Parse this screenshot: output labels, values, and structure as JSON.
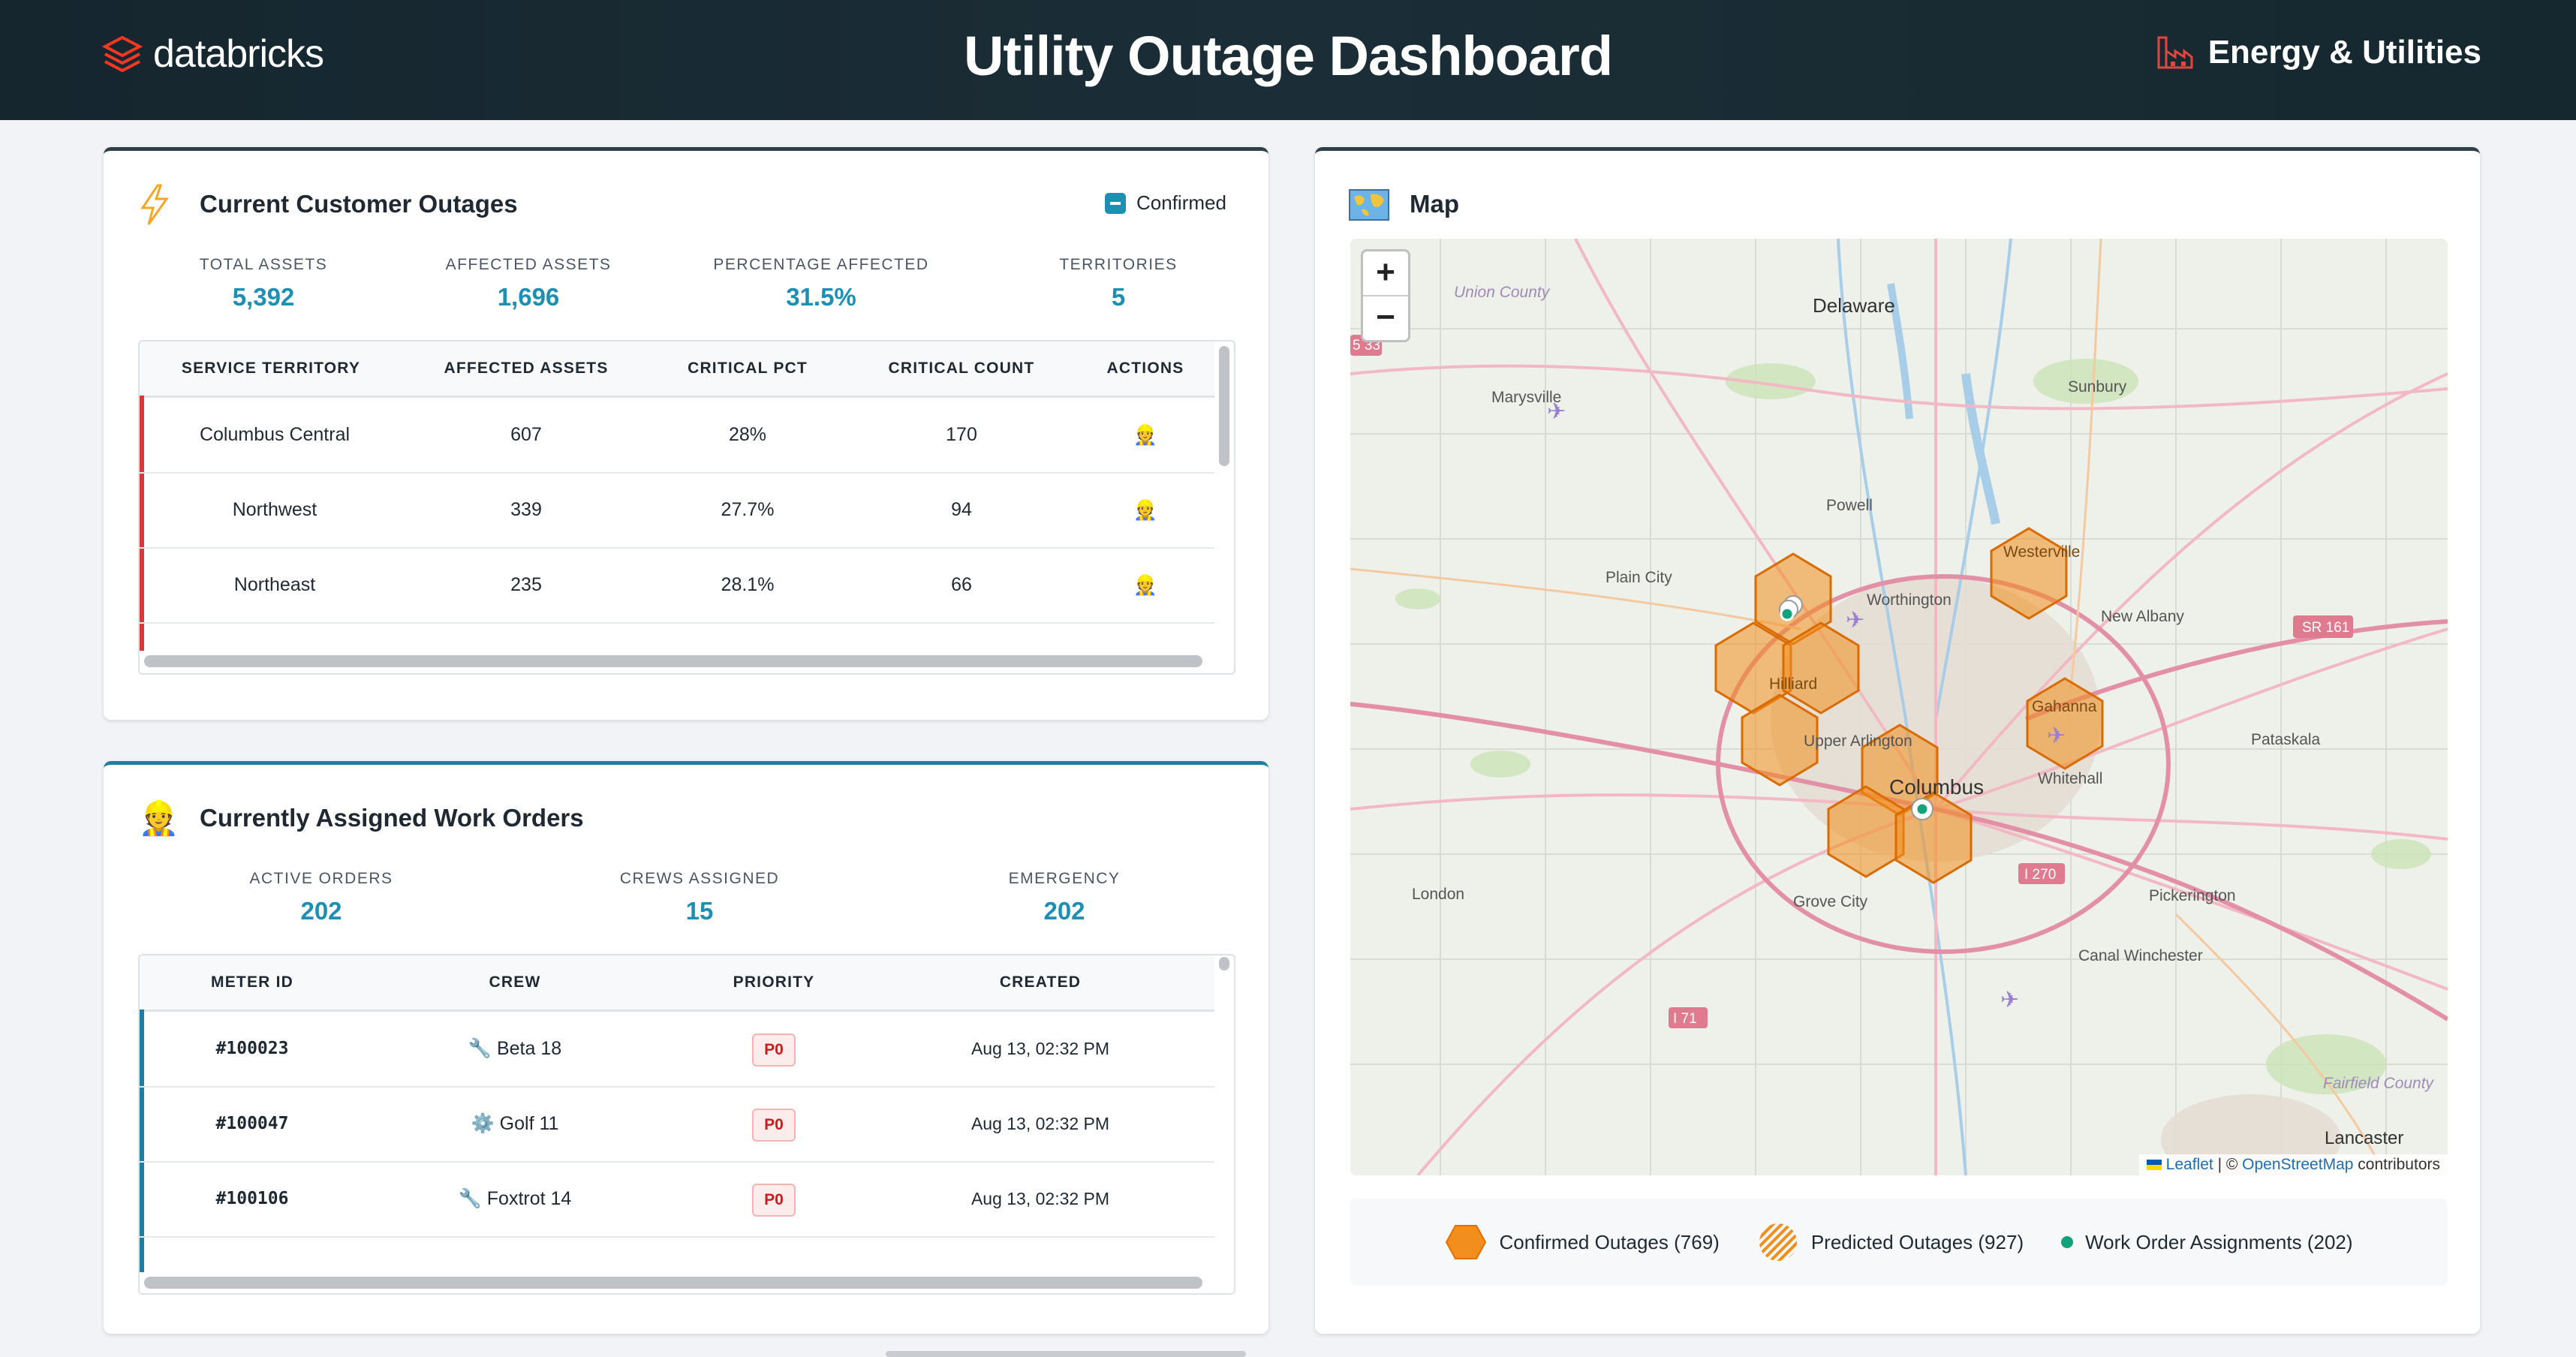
{
  "header": {
    "brand": "databricks",
    "title": "Utility Outage Dashboard",
    "industry": "Energy & Utilities"
  },
  "outages": {
    "title": "Current Customer Outages",
    "filter_label": "Confirmed",
    "metrics": [
      {
        "label": "TOTAL ASSETS",
        "value": "5,392"
      },
      {
        "label": "AFFECTED ASSETS",
        "value": "1,696"
      },
      {
        "label": "PERCENTAGE AFFECTED",
        "value": "31.5%"
      },
      {
        "label": "TERRITORIES",
        "value": "5"
      }
    ],
    "columns": [
      "SERVICE TERRITORY",
      "AFFECTED ASSETS",
      "CRITICAL PCT",
      "CRITICAL COUNT",
      "ACTIONS"
    ],
    "rows": [
      {
        "territory": "Columbus Central",
        "affected": "607",
        "pct": "28%",
        "count": "170",
        "action": "👷"
      },
      {
        "territory": "Northwest",
        "affected": "339",
        "pct": "27.7%",
        "count": "94",
        "action": "👷"
      },
      {
        "territory": "Northeast",
        "affected": "235",
        "pct": "28.1%",
        "count": "66",
        "action": "👷"
      }
    ]
  },
  "workorders": {
    "title": "Currently Assigned Work Orders",
    "metrics": [
      {
        "label": "ACTIVE ORDERS",
        "value": "202"
      },
      {
        "label": "CREWS ASSIGNED",
        "value": "15"
      },
      {
        "label": "EMERGENCY",
        "value": "202"
      }
    ],
    "columns": [
      "METER ID",
      "CREW",
      "PRIORITY",
      "CREATED"
    ],
    "rows": [
      {
        "meter": "#100023",
        "crew_icon": "🔧",
        "crew": "Beta 18",
        "priority": "P0",
        "created": "Aug 13, 02:32 PM"
      },
      {
        "meter": "#100047",
        "crew_icon": "⚙️",
        "crew": "Golf 11",
        "priority": "P0",
        "created": "Aug 13, 02:32 PM"
      },
      {
        "meter": "#100106",
        "crew_icon": "🔧",
        "crew": "Foxtrot 14",
        "priority": "P0",
        "created": "Aug 13, 02:32 PM"
      }
    ]
  },
  "map": {
    "title": "Map",
    "zoom_in": "+",
    "zoom_out": "−",
    "attribution": {
      "leaflet": "Leaflet",
      "sep": " | © ",
      "osm": "OpenStreetMap",
      "suffix": " contributors"
    },
    "labels": {
      "union_county": "Union County",
      "delaware": "Delaware",
      "marysville": "Marysville",
      "sunbury": "Sunbury",
      "powell": "Powell",
      "westerville": "Westerville",
      "plain_city": "Plain City",
      "worthington": "Worthington",
      "new_albany": "New Albany",
      "sr161": "SR 161",
      "hilliard": "Hilliard",
      "gahanna": "Gahanna",
      "upper_arlington": "Upper Arlington",
      "pataskala": "Pataskala",
      "columbus": "Columbus",
      "whitehall": "Whitehall",
      "london": "London",
      "i270": "I 270",
      "grove_city": "Grove City",
      "pickerington": "Pickerington",
      "canal_winchester": "Canal Winchester",
      "i71": "I 71",
      "fairfield_county": "Fairfield County",
      "lancaster": "Lancaster",
      "i33": "5 33"
    }
  },
  "legend": {
    "confirmed": "Confirmed Outages (769)",
    "predicted": "Predicted Outages (927)",
    "workorders": "Work Order Assignments (202)",
    "colors": {
      "confirmed": "#f28e1c",
      "work_order": "#12a37c"
    }
  }
}
